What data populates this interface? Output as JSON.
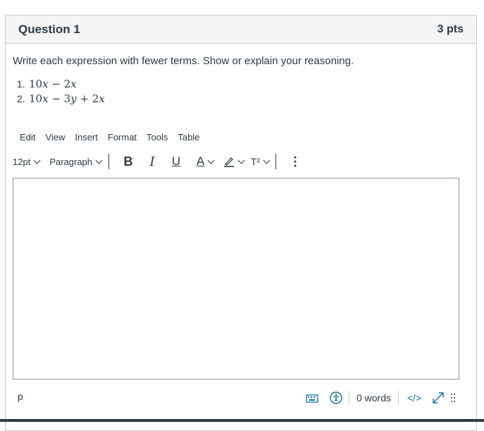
{
  "question": {
    "title": "Question 1",
    "points": "3 pts",
    "prompt": "Write each expression with fewer terms. Show or explain your reasoning.",
    "items": [
      {
        "number": "1.",
        "expression": "10x − 2x"
      },
      {
        "number": "2.",
        "expression": "10x − 3y + 2x"
      }
    ]
  },
  "editor": {
    "menu": [
      "Edit",
      "View",
      "Insert",
      "Format",
      "Tools",
      "Table"
    ],
    "font_size": "12pt",
    "block_format": "Paragraph",
    "status_path": "p",
    "word_count": "0 words",
    "html_toggle": "</>",
    "superscript_label": "T²"
  },
  "colors": {
    "text": "#2d3b45",
    "border": "#c7cdd1",
    "link_blue": "#0770a3",
    "header_bg": "#f5f5f5"
  }
}
